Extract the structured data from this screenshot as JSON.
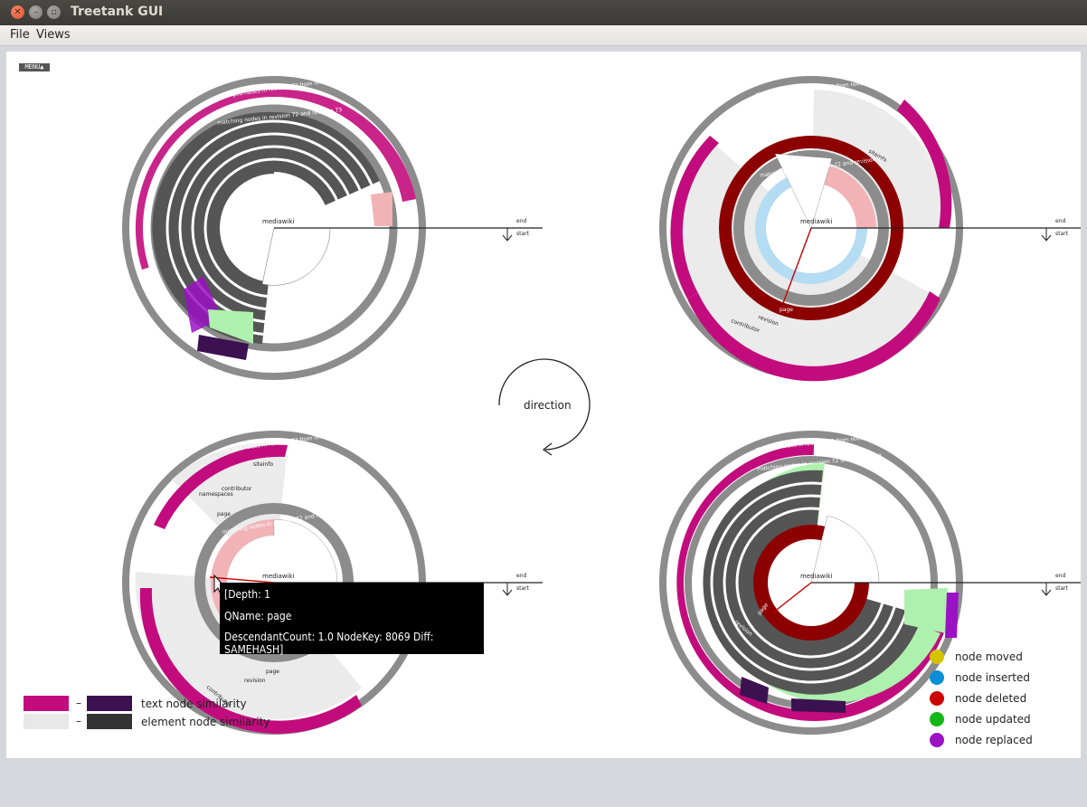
{
  "window": {
    "title": "Treetank GUI"
  },
  "menubar": {
    "file": "File",
    "views": "Views"
  },
  "menu_tag": "MENU▲",
  "direction_label": "direction",
  "panels": [
    {
      "outer_label": "changed nodes in revision 72 from revision 73",
      "inner_label": "matching nodes in revision 72 and revision 73",
      "root": "mediawiki",
      "end_label": "end",
      "start_label": "start"
    },
    {
      "outer_label": "changed nodes in revision 72 from revision 73",
      "inner_label": "matching nodes in revision 72 and revision 73",
      "root": "mediawiki",
      "end_label": "end",
      "start_label": "start",
      "labels": [
        "siteinfo",
        "page",
        "revision",
        "page",
        "contributor"
      ]
    },
    {
      "outer_label": "changed nodes in revision 72 from revision 73",
      "inner_label": "matching nodes in revision 72 and revision 73",
      "root": "mediawiki",
      "end_label": "end",
      "start_label": "start",
      "labels": [
        "siteinfo",
        "namespaces",
        "contributor",
        "page",
        "page",
        "revision",
        "contributor"
      ]
    },
    {
      "outer_label": "changed nodes in revision 72 from revision 73",
      "inner_label": "matching nodes in revision 72 and revision 73",
      "root": "mediawiki",
      "end_label": "end",
      "start_label": "start",
      "labels": [
        "page",
        "revision"
      ]
    }
  ],
  "tooltip": {
    "line1": "[Depth: 1",
    "line2": "QName: page",
    "line3": "DescendantCount: 1.0 NodeKey: 8069 Diff: SAMEHASH]"
  },
  "similarity_legend": [
    {
      "label": "text node similarity",
      "dash": "–",
      "from": "#c20c7d",
      "to": "#3c1151"
    },
    {
      "label": "element node similarity",
      "dash": "–",
      "from": "#e8e8e8",
      "to": "#333333"
    }
  ],
  "diff_legend": [
    {
      "label": "node moved",
      "color": "#d4c400"
    },
    {
      "label": "node inserted",
      "color": "#0a8fd6"
    },
    {
      "label": "node deleted",
      "color": "#cc0000"
    },
    {
      "label": "node updated",
      "color": "#14b814"
    },
    {
      "label": "node replaced",
      "color": "#9a12c4"
    }
  ]
}
